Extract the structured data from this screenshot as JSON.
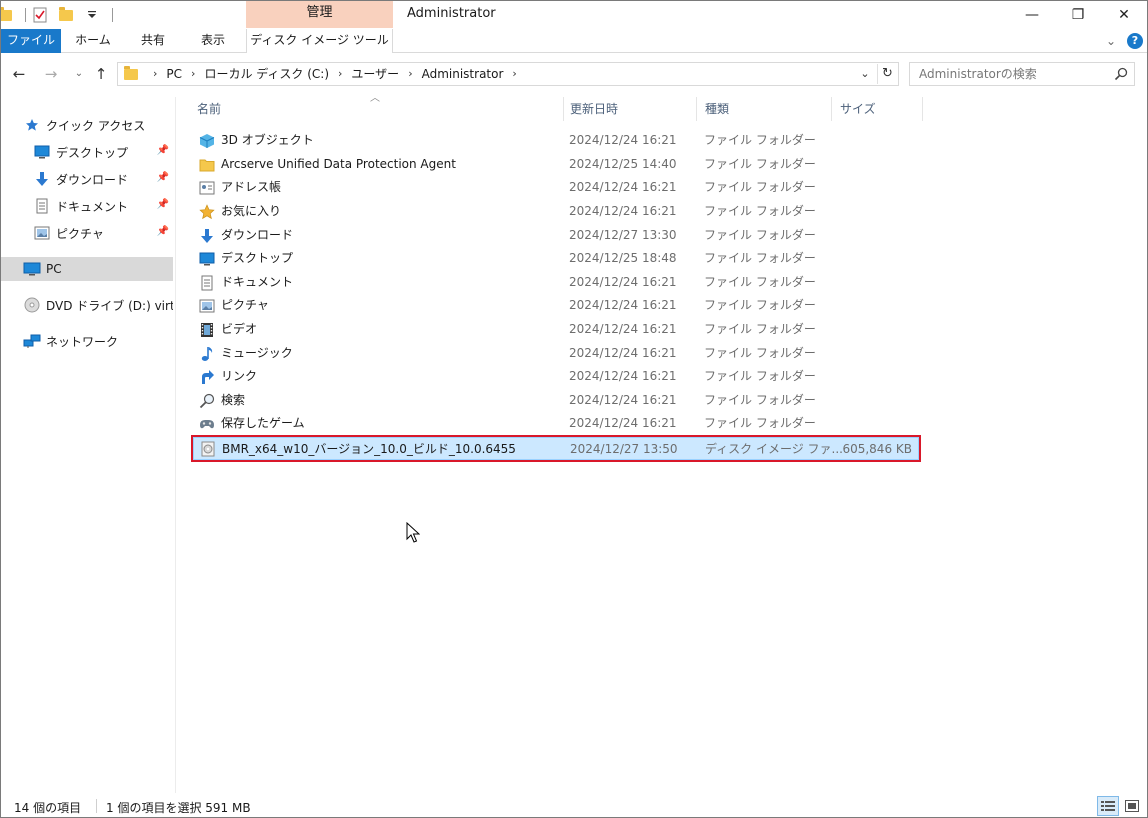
{
  "titlebar": {
    "manage_tab": "管理",
    "window_title": "Administrator",
    "minimize": "—",
    "restore": "❐",
    "close": "✕"
  },
  "ribbon": {
    "tabs": [
      {
        "label": "ファイル"
      },
      {
        "label": "ホーム"
      },
      {
        "label": "共有"
      },
      {
        "label": "表示"
      },
      {
        "label": "ディスク イメージ ツール"
      }
    ]
  },
  "address": {
    "crumbs": [
      "PC",
      "ローカル ディスク (C:)",
      "ユーザー",
      "Administrator"
    ],
    "search_placeholder": "Administratorの検索"
  },
  "navpane": {
    "items": [
      {
        "label": "クイック アクセス",
        "icon": "star-icon"
      },
      {
        "label": "デスクトップ",
        "icon": "desktop-icon",
        "pinned": true
      },
      {
        "label": "ダウンロード",
        "icon": "download-icon",
        "pinned": true
      },
      {
        "label": "ドキュメント",
        "icon": "document-icon",
        "pinned": true
      },
      {
        "label": "ピクチャ",
        "icon": "picture-icon",
        "pinned": true
      },
      {
        "label": "PC",
        "icon": "pc-icon",
        "selected": true
      },
      {
        "label": "DVD ドライブ (D:) virtio",
        "icon": "dvd-icon"
      },
      {
        "label": "ネットワーク",
        "icon": "network-icon"
      }
    ]
  },
  "columns": {
    "name": "名前",
    "date": "更新日時",
    "type": "種類",
    "size": "サイズ"
  },
  "files": [
    {
      "name": "3D オブジェクト",
      "date": "2024/12/24 16:21",
      "type": "ファイル フォルダー",
      "size": "",
      "icon": "3d-objects-icon"
    },
    {
      "name": "Arcserve Unified Data Protection Agent",
      "date": "2024/12/25 14:40",
      "type": "ファイル フォルダー",
      "size": "",
      "icon": "folder-icon"
    },
    {
      "name": "アドレス帳",
      "date": "2024/12/24 16:21",
      "type": "ファイル フォルダー",
      "size": "",
      "icon": "contacts-icon"
    },
    {
      "name": "お気に入り",
      "date": "2024/12/24 16:21",
      "type": "ファイル フォルダー",
      "size": "",
      "icon": "favorites-icon"
    },
    {
      "name": "ダウンロード",
      "date": "2024/12/27 13:30",
      "type": "ファイル フォルダー",
      "size": "",
      "icon": "download-icon"
    },
    {
      "name": "デスクトップ",
      "date": "2024/12/25 18:48",
      "type": "ファイル フォルダー",
      "size": "",
      "icon": "desktop-icon"
    },
    {
      "name": "ドキュメント",
      "date": "2024/12/24 16:21",
      "type": "ファイル フォルダー",
      "size": "",
      "icon": "document-icon"
    },
    {
      "name": "ピクチャ",
      "date": "2024/12/24 16:21",
      "type": "ファイル フォルダー",
      "size": "",
      "icon": "picture-icon"
    },
    {
      "name": "ビデオ",
      "date": "2024/12/24 16:21",
      "type": "ファイル フォルダー",
      "size": "",
      "icon": "video-icon"
    },
    {
      "name": "ミュージック",
      "date": "2024/12/24 16:21",
      "type": "ファイル フォルダー",
      "size": "",
      "icon": "music-icon"
    },
    {
      "name": "リンク",
      "date": "2024/12/24 16:21",
      "type": "ファイル フォルダー",
      "size": "",
      "icon": "links-icon"
    },
    {
      "name": "検索",
      "date": "2024/12/24 16:21",
      "type": "ファイル フォルダー",
      "size": "",
      "icon": "search-folder-icon"
    },
    {
      "name": "保存したゲーム",
      "date": "2024/12/24 16:21",
      "type": "ファイル フォルダー",
      "size": "",
      "icon": "saved-games-icon"
    },
    {
      "name": "BMR_x64_w10_バージョン_10.0_ビルド_10.0.6455",
      "date": "2024/12/27 13:50",
      "type": "ディスク イメージ ファ...",
      "size": "605,846 KB",
      "icon": "disc-image-icon",
      "selected": true
    }
  ],
  "status": {
    "count": "14 個の項目",
    "selection": "1 個の項目を選択  591 MB"
  },
  "colors": {
    "accent": "#1979ca",
    "manage_tab": "#f9d1be",
    "selection": "#cce8ff",
    "highlight_border": "#d9182a"
  }
}
